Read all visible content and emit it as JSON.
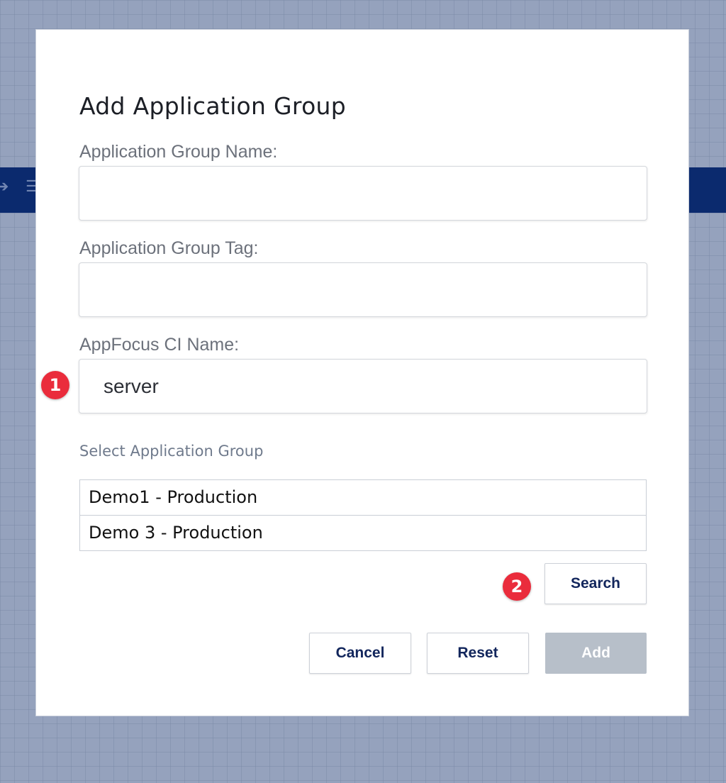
{
  "dialog": {
    "title": "Add Application Group",
    "fields": {
      "group_name": {
        "label": "Application Group Name:",
        "value": ""
      },
      "group_tag": {
        "label": "Application Group Tag:",
        "value": ""
      },
      "ci_name": {
        "label": "AppFocus CI Name:",
        "value": "server"
      }
    },
    "select_label": "Select Application Group",
    "groups": [
      "Demo1 - Production",
      "Demo 3 - Production"
    ],
    "buttons": {
      "search": "Search",
      "cancel": "Cancel",
      "reset": "Reset",
      "add": "Add"
    }
  },
  "badges": {
    "step1": "1",
    "step2": "2"
  },
  "colors": {
    "badge": "#ea2c3c",
    "button_text": "#12265c",
    "disabled_button": "#b7bfc9",
    "header_band": "#0b2a6e",
    "backdrop": "#95a2bd"
  }
}
